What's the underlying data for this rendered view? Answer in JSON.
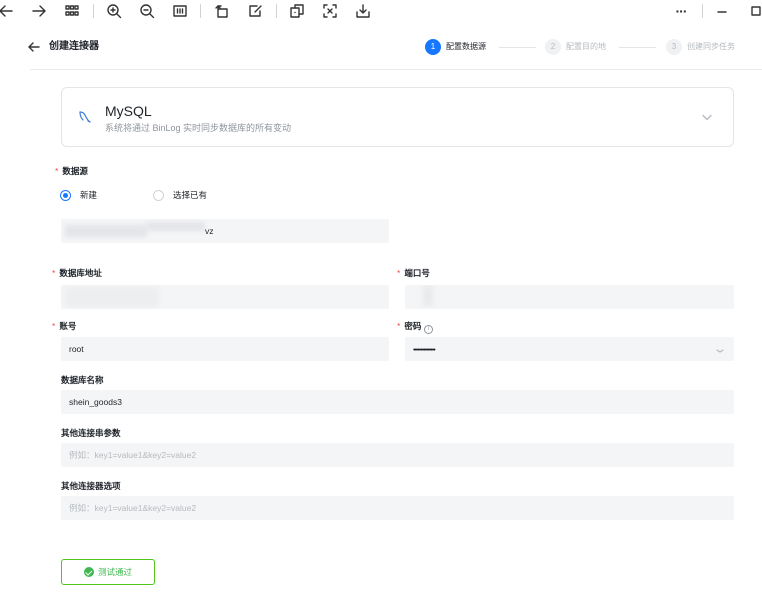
{
  "toolbar": {
    "icons": [
      "back-arrow-icon",
      "forward-arrow-icon",
      "grid-icon",
      "zoom-in-icon",
      "zoom-out-icon",
      "fit-icon",
      "rotate-icon",
      "edit-icon",
      "copy-icon",
      "capture-icon",
      "save-icon",
      "more-icon",
      "minimize-icon",
      "maximize-icon"
    ],
    "more": "···"
  },
  "header": {
    "title": "创建连接器",
    "steps": [
      {
        "number": "1",
        "label": "配置数据源",
        "state": "active"
      },
      {
        "number": "2",
        "label": "配置目的地",
        "state": "inactive"
      },
      {
        "number": "3",
        "label": "创建同步任务",
        "state": "inactive"
      }
    ]
  },
  "connector": {
    "name": "MySQL",
    "description": "系统将通过 BinLog 实时同步数据库的所有变动",
    "icon": "mysql-dolphin-icon"
  },
  "form": {
    "datasource_label": "数据源",
    "radio_new": "新建",
    "radio_existing": "选择已有",
    "selected": "new",
    "name_value": "vz",
    "host_label": "数据库地址",
    "port_label": "端口号",
    "account_label": "账号",
    "account_value": "root",
    "password_label": "密码",
    "password_value": "•••••••••••••••",
    "dbname_label": "数据库名称",
    "dbname_value": "shein_goods3",
    "conn_params_label": "其他连接串参数",
    "conn_params_placeholder": "例如：key1=value1&key2=value2",
    "connector_options_label": "其他连接器选项",
    "connector_options_placeholder": "例如：key1=value1&key2=value2",
    "required_mark": "*",
    "info_glyph": "i"
  },
  "actions": {
    "test_label": "测试通过"
  },
  "colors": {
    "primary": "#1677ff",
    "success": "#3fb94f",
    "required": "#f54a45"
  }
}
